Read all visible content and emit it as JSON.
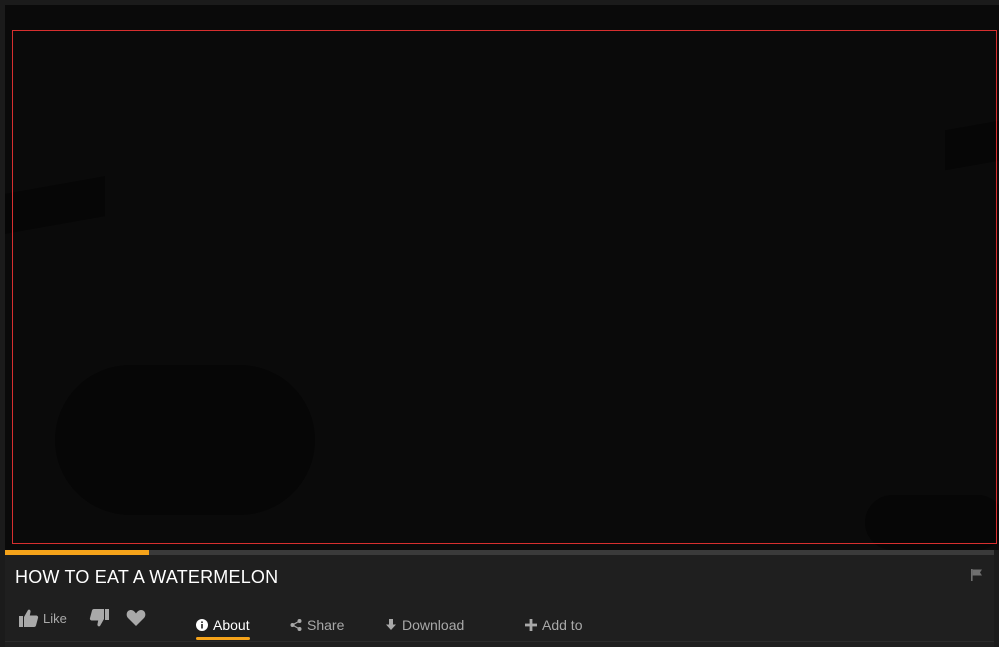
{
  "video": {
    "title": "HOW TO EAT A WATERMELON",
    "progress_fraction": 0.146
  },
  "actions": {
    "like_label": "Like",
    "dislike_icon": "thumbs-down-icon",
    "favorite_icon": "heart-icon"
  },
  "tabs": [
    {
      "label": "About",
      "icon": "info-icon",
      "active": true
    },
    {
      "label": "Share",
      "icon": "share-icon",
      "active": false
    },
    {
      "label": "Download",
      "icon": "download-icon",
      "active": false
    },
    {
      "label": "Add to",
      "icon": "plus-icon",
      "active": false
    }
  ],
  "colors": {
    "accent": "#f5a31a",
    "frame_border": "#d72f2f",
    "background": "#1b1b1b"
  }
}
